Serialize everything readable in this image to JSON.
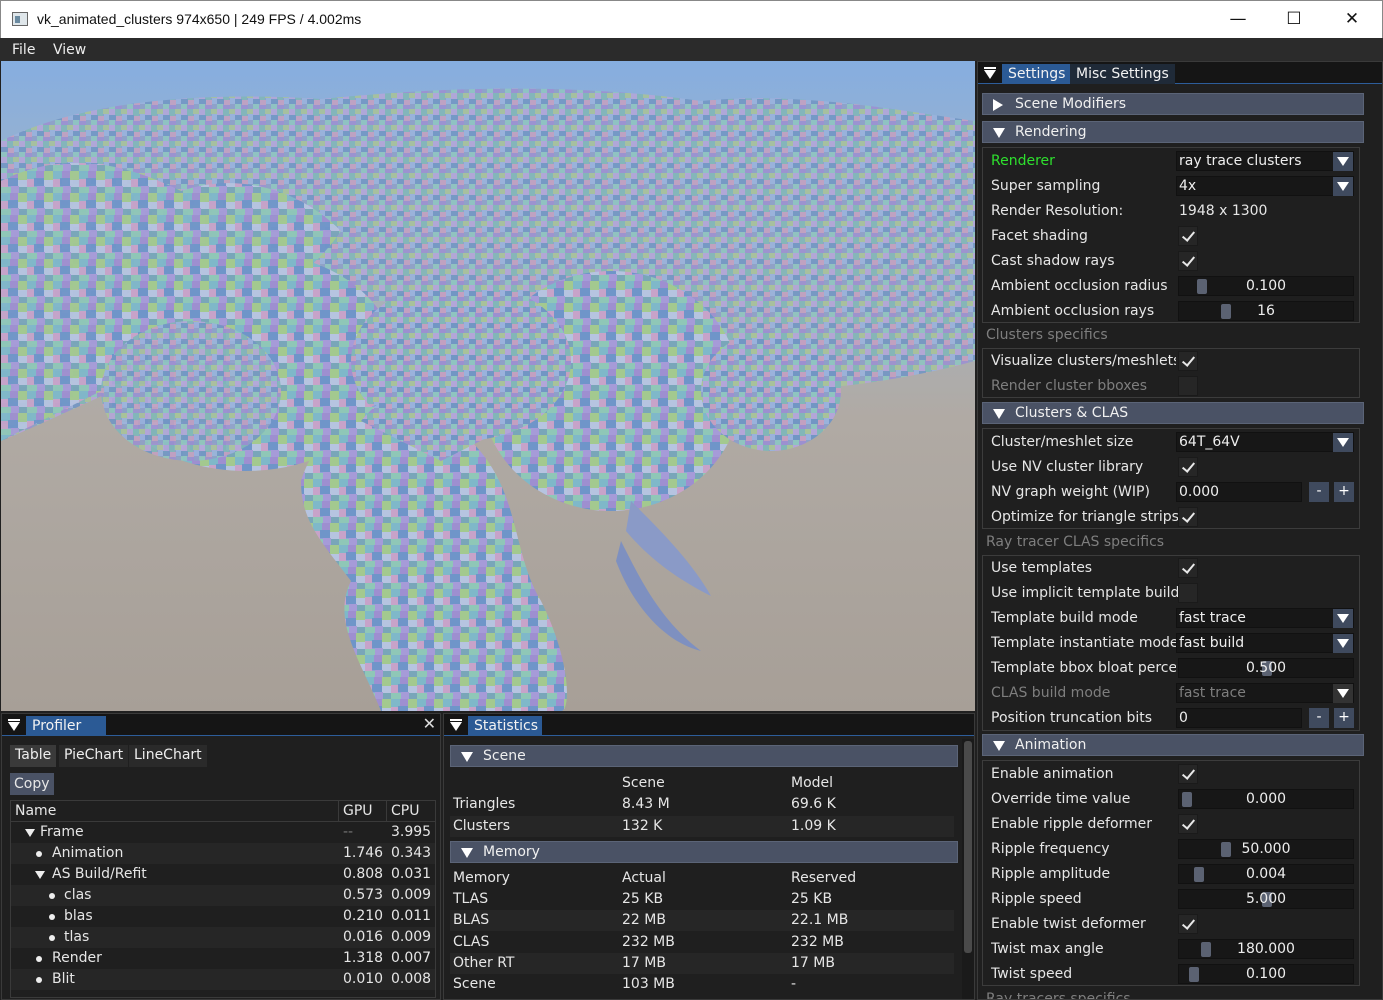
{
  "window": {
    "title": "vk_animated_clusters 974x650 | 249 FPS / 4.002ms",
    "minimize": "—",
    "maximize": "☐",
    "close": "✕"
  },
  "menu": {
    "file": "File",
    "view": "View"
  },
  "settings": {
    "tabs": [
      "Settings",
      "Misc Settings"
    ],
    "scene_modifiers": "Scene Modifiers",
    "rendering": {
      "header": "Rendering",
      "renderer_label": "Renderer",
      "renderer_value": "ray trace clusters",
      "super_sampling_label": "Super sampling",
      "super_sampling_value": "4x",
      "render_res_label": "Render Resolution:",
      "render_res_value": "1948 x 1300",
      "facet_label": "Facet shading",
      "shadow_label": "Cast shadow rays",
      "ao_radius_label": "Ambient occlusion radius",
      "ao_radius_value": "0.100",
      "ao_rays_label": "Ambient occlusion rays",
      "ao_rays_value": "16"
    },
    "clusters_specifics": {
      "title": "Clusters specifics",
      "visualize_label": "Visualize clusters/meshlets",
      "bboxes_label": "Render cluster bboxes"
    },
    "clusters_clas": {
      "header": "Clusters & CLAS",
      "size_label": "Cluster/meshlet size",
      "size_value": "64T_64V",
      "nvlib_label": "Use NV cluster library",
      "graph_label": "NV graph weight (WIP)",
      "graph_value": "0.000",
      "strips_label": "Optimize for triangle strips"
    },
    "rt_clas": {
      "title": "Ray tracer CLAS specifics",
      "templates_label": "Use templates",
      "implicit_label": "Use implicit template build",
      "build_mode_label": "Template build mode",
      "build_mode_value": "fast trace",
      "inst_mode_label": "Template instantiate mode",
      "inst_mode_value": "fast build",
      "bloat_label": "Template bbox bloat percer",
      "bloat_value": "0.500",
      "clas_build_label": "CLAS build mode",
      "clas_build_value": "fast trace",
      "pos_trunc_label": "Position truncation bits",
      "pos_trunc_value": "0"
    },
    "animation": {
      "header": "Animation",
      "enable_label": "Enable animation",
      "override_label": "Override time value",
      "override_value": "0.000",
      "ripple_label": "Enable ripple deformer",
      "ripple_freq_label": "Ripple frequency",
      "ripple_freq_value": "50.000",
      "ripple_amp_label": "Ripple amplitude",
      "ripple_amp_value": "0.004",
      "ripple_speed_label": "Ripple speed",
      "ripple_speed_value": "5.000",
      "twist_label": "Enable twist deformer",
      "twist_angle_label": "Twist max angle",
      "twist_angle_value": "180.000",
      "twist_speed_label": "Twist speed",
      "twist_speed_value": "0.100"
    },
    "cut_text": "Ray tracers specifics",
    "minus": "-",
    "plus": "+"
  },
  "profiler": {
    "title": "Profiler",
    "tabs": [
      "Table",
      "PieChart",
      "LineChart"
    ],
    "copy": "Copy",
    "columns": [
      "Name",
      "GPU",
      "CPU"
    ],
    "rows": [
      {
        "name": "Frame",
        "gpu": "--",
        "cpu": "3.995"
      },
      {
        "name": "Animation",
        "gpu": "1.746",
        "cpu": "0.343"
      },
      {
        "name": "AS Build/Refit",
        "gpu": "0.808",
        "cpu": "0.031"
      },
      {
        "name": "clas",
        "gpu": "0.573",
        "cpu": "0.009"
      },
      {
        "name": "blas",
        "gpu": "0.210",
        "cpu": "0.011"
      },
      {
        "name": "tlas",
        "gpu": "0.016",
        "cpu": "0.009"
      },
      {
        "name": "Render",
        "gpu": "1.318",
        "cpu": "0.007"
      },
      {
        "name": "Blit",
        "gpu": "0.010",
        "cpu": "0.008"
      }
    ]
  },
  "statistics": {
    "title": "Statistics",
    "scene_header": "Scene",
    "scene_cols": [
      "",
      "Scene",
      "Model"
    ],
    "scene_rows": [
      {
        "label": "Triangles",
        "a": "8.43 M",
        "b": "69.6 K"
      },
      {
        "label": "Clusters",
        "a": "132 K",
        "b": "1.09 K"
      }
    ],
    "memory_header": "Memory",
    "mem_cols": [
      "Memory",
      "Actual",
      "Reserved"
    ],
    "mem_rows": [
      {
        "label": "TLAS",
        "a": "25 KB",
        "b": "25 KB"
      },
      {
        "label": "BLAS",
        "a": "22 MB",
        "b": "22.1 MB"
      },
      {
        "label": "CLAS",
        "a": "232 MB",
        "b": "232 MB"
      },
      {
        "label": "Other RT",
        "a": "17 MB",
        "b": "17 MB"
      },
      {
        "label": "Scene",
        "a": "103 MB",
        "b": "-"
      }
    ]
  }
}
